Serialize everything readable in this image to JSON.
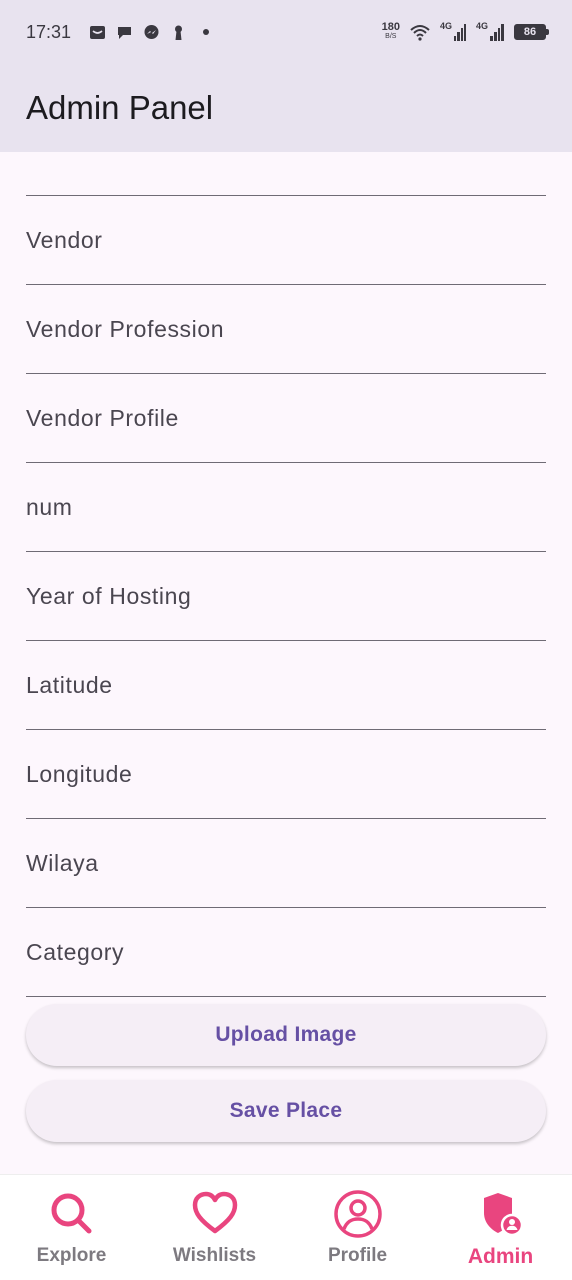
{
  "status_bar": {
    "time": "17:31",
    "net_speed_value": "180",
    "net_speed_unit": "B/S",
    "signal1_label": "4G",
    "signal2_label": "4G",
    "battery": "86",
    "icons": [
      "mail-icon",
      "chat-icon",
      "messenger-icon",
      "keyhole-icon",
      "dot-icon",
      "wifi-icon",
      "signal-icon",
      "battery-icon"
    ]
  },
  "app_bar": {
    "title": "Admin Panel"
  },
  "form": {
    "fields": [
      "Vendor",
      "Vendor Profession",
      "Vendor Profile",
      "num",
      "Year of Hosting",
      "Latitude",
      "Longitude",
      "Wilaya",
      "Category"
    ]
  },
  "buttons": {
    "upload": "Upload Image",
    "save": "Save Place"
  },
  "bottom_nav": {
    "items": [
      {
        "label": "Explore",
        "icon": "search-icon"
      },
      {
        "label": "Wishlists",
        "icon": "heart-icon"
      },
      {
        "label": "Profile",
        "icon": "user-circle-icon"
      },
      {
        "label": "Admin",
        "icon": "admin-shield-icon",
        "active": true
      }
    ]
  },
  "colors": {
    "accent": "#e9457f",
    "button_text": "#6650a4",
    "app_bar_bg": "#e8e3ef",
    "page_bg": "#fdf7fd"
  }
}
